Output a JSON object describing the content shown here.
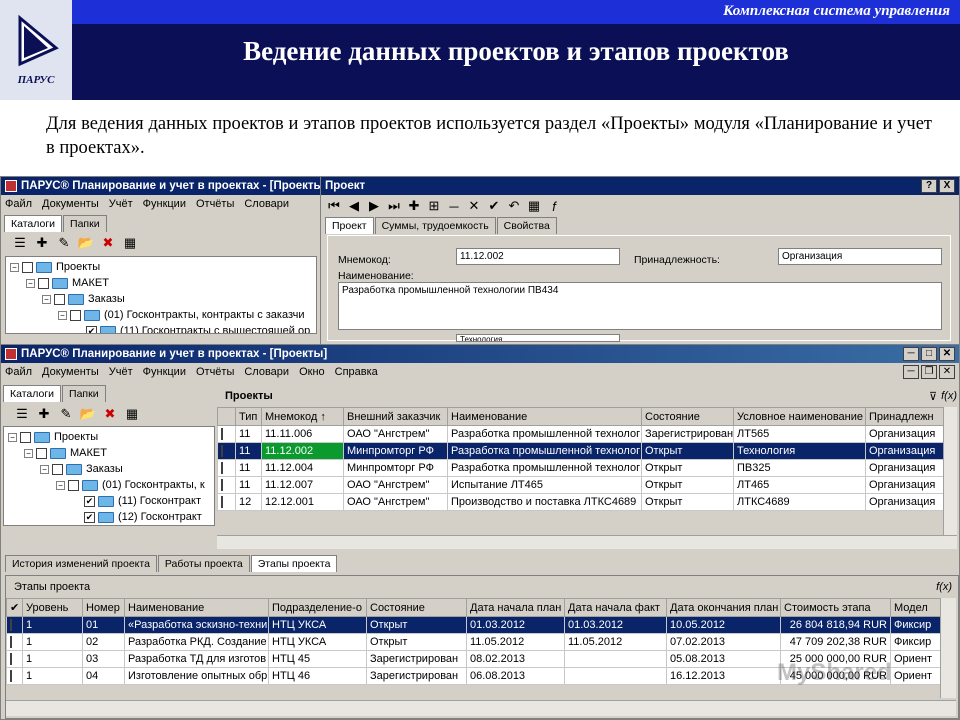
{
  "header": {
    "brand_top": "Комплексная система управления",
    "logo_text": "ПАРУС",
    "title": "Ведение данных проектов и этапов проектов"
  },
  "intro": "Для ведения данных проектов и этапов проектов используется раздел «Проекты» модуля «Планирование и учет в проектах».",
  "back_window": {
    "title": "ПАРУС® Планирование и учет в проектах - [Проекты]",
    "menu": [
      "Файл",
      "Документы",
      "Учёт",
      "Функции",
      "Отчёты",
      "Словари"
    ],
    "tabs": [
      "Каталоги",
      "Папки"
    ],
    "tree": [
      {
        "label": "Проекты",
        "level": 0,
        "checked": false
      },
      {
        "label": "МАКЕТ",
        "level": 1,
        "checked": false
      },
      {
        "label": "Заказы",
        "level": 2,
        "checked": false
      },
      {
        "label": "(01) Госконтракты, контракты с заказчи",
        "level": 3,
        "checked": false
      },
      {
        "label": "(11) Госконтракты с вышестоящей ор",
        "level": 4,
        "checked": true
      }
    ]
  },
  "dialog": {
    "title": "Проект",
    "tabs": [
      "Проект",
      "Суммы, трудоемкость",
      "Свойства"
    ],
    "mnemo_label": "Мнемокод:",
    "mnemo_value": "11.12.002",
    "owner_label": "Принадлежность:",
    "owner_value": "Организация",
    "name_label": "Наименование:",
    "name_value": "Разработка промышленной технологии ПВ434",
    "partial_value": "Технология",
    "help_btn": "?",
    "close_btn": "X"
  },
  "front_window": {
    "title": "ПАРУС® Планирование и учет в проектах - [Проекты]",
    "menu": [
      "Файл",
      "Документы",
      "Учёт",
      "Функции",
      "Отчёты",
      "Словари",
      "Окно",
      "Справка"
    ],
    "tabs": [
      "Каталоги",
      "Папки"
    ],
    "tree": [
      {
        "label": "Проекты",
        "level": 0,
        "checked": false
      },
      {
        "label": "МАКЕТ",
        "level": 1,
        "checked": false
      },
      {
        "label": "Заказы",
        "level": 2,
        "checked": false
      },
      {
        "label": "(01) Госконтракты, к",
        "level": 3,
        "checked": false
      },
      {
        "label": "(11) Госконтракт",
        "level": 4,
        "checked": true
      },
      {
        "label": "(12) Госконтракт",
        "level": 4,
        "checked": true
      }
    ],
    "projects_header": "Проекты",
    "fx": "f(x)",
    "columns": [
      "Тип",
      "Мнемокод",
      "Внешний заказчик",
      "Наименование",
      "Состояние",
      "Условное наименование",
      "Принадлежн"
    ],
    "sort_glyph": "↑",
    "rows": [
      [
        "11",
        "11.11.006",
        "ОАО \"Ангстрем\"",
        "Разработка промышленной технолог",
        "Зарегистрирован",
        "ЛТ565",
        "Организация"
      ],
      [
        "11",
        "11.12.002",
        "Минпромторг РФ",
        "Разработка промышленной технолог",
        "Открыт",
        "Технология",
        "Организация"
      ],
      [
        "11",
        "11.12.004",
        "Минпромторг РФ",
        "Разработка промышленной технолог",
        "Открыт",
        "ПВ325",
        "Организация"
      ],
      [
        "11",
        "11.12.007",
        "ОАО \"Ангстрем\"",
        "Испытание ЛТ465",
        "Открыт",
        "ЛТ465",
        "Организация"
      ],
      [
        "12",
        "12.12.001",
        "ОАО \"Ангстрем\"",
        "Производство и поставка ЛТКС4689",
        "Открыт",
        "ЛТКС4689",
        "Организация"
      ]
    ],
    "selected_row": 1,
    "bottom_tabs": [
      "История изменений проекта",
      "Работы проекта",
      "Этапы проекта"
    ],
    "stages_header": "Этапы проекта",
    "stage_columns": [
      "Уровень",
      "Номер",
      "Наименование",
      "Подразделение-о",
      "Состояние",
      "Дата начала план",
      "Дата начала факт",
      "Дата окончания план",
      "Стоимость этапа",
      "Модел"
    ],
    "stages": [
      [
        "1",
        "01",
        "«Разработка эскизно-техни",
        "НТЦ УКСА",
        "Открыт",
        "01.03.2012",
        "01.03.2012",
        "10.05.2012",
        "26 804 818,94 RUR",
        "Фиксир"
      ],
      [
        "1",
        "02",
        "Разработка РКД. Создание",
        "НТЦ УКСА",
        "Открыт",
        "11.05.2012",
        "11.05.2012",
        "07.02.2013",
        "47 709 202,38 RUR",
        "Фиксир"
      ],
      [
        "1",
        "03",
        "Разработка ТД для изготов",
        "НТЦ 45",
        "Зарегистрирован",
        "08.02.2013",
        "",
        "05.08.2013",
        "25 000 000,00 RUR",
        "Ориент"
      ],
      [
        "1",
        "04",
        "Изготовление опытных обр",
        "НТЦ 46",
        "Зарегистрирован",
        "06.08.2013",
        "",
        "16.12.2013",
        "45 000 000,00 RUR",
        "Ориент"
      ]
    ],
    "selected_stage": 0
  },
  "watermark": "MyShared"
}
